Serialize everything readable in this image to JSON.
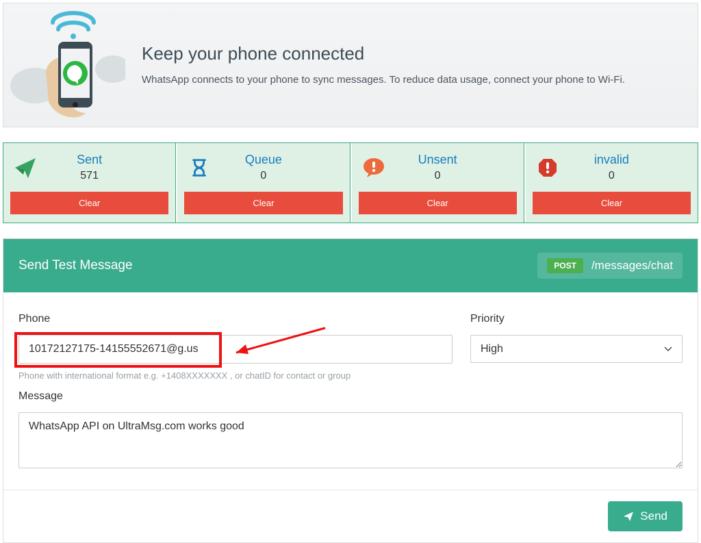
{
  "banner": {
    "title": "Keep your phone connected",
    "text": "WhatsApp connects to your phone to sync messages. To reduce data usage, connect your phone to Wi-Fi."
  },
  "stats": [
    {
      "label": "Sent",
      "value": "571",
      "clear": "Clear"
    },
    {
      "label": "Queue",
      "value": "0",
      "clear": "Clear"
    },
    {
      "label": "Unsent",
      "value": "0",
      "clear": "Clear"
    },
    {
      "label": "invalid",
      "value": "0",
      "clear": "Clear"
    }
  ],
  "panel": {
    "title": "Send Test Message",
    "method": "POST",
    "endpoint": "/messages/chat",
    "phone_label": "Phone",
    "phone_value": "10172127175-14155552671@g.us",
    "phone_hint": "Phone with international format e.g. +1408XXXXXXX , or chatID for contact or group",
    "priority_label": "Priority",
    "priority_value": "High",
    "message_label": "Message",
    "message_value": "WhatsApp API on UltraMsg.com works good",
    "send": "Send"
  }
}
